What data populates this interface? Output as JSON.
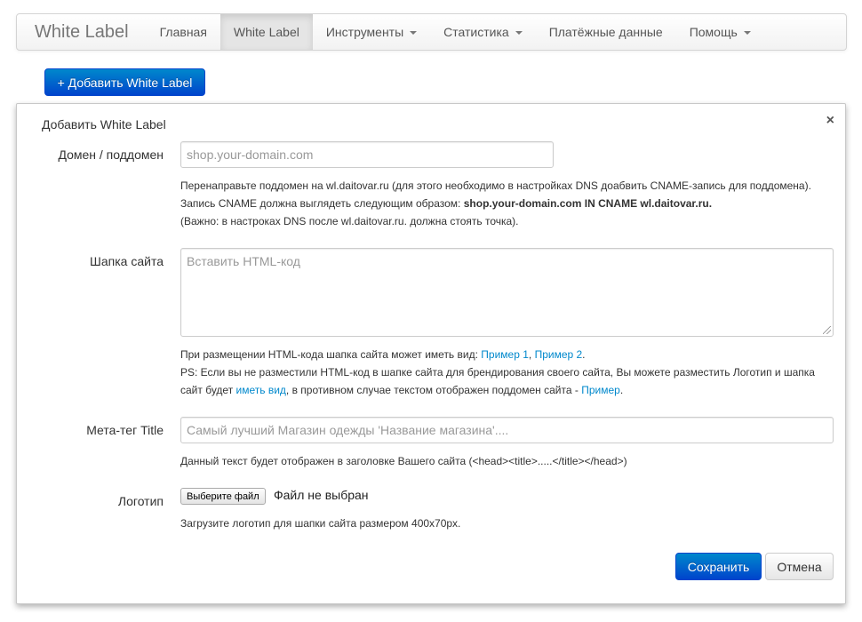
{
  "navbar": {
    "brand": "White Label",
    "items": [
      {
        "label": "Главная"
      },
      {
        "label": "White Label"
      },
      {
        "label": "Инструменты"
      },
      {
        "label": "Статистика"
      },
      {
        "label": "Платёжные данные"
      },
      {
        "label": "Помощь"
      }
    ],
    "active_item": "White Label"
  },
  "add_button": "+ Добавить White Label",
  "modal": {
    "title": "Добавить White Label",
    "close": "×",
    "domain": {
      "label": "Домен / поддомен",
      "placeholder": "shop.your-domain.com",
      "help_line1": "Перенаправьте поддомен на wl.daitovar.ru (для этого необходимо в настройках DNS доабвить CNAME-запись для поддомена).",
      "help_line2_prefix": "Запись CNAME должна выглядеть следующим образом: ",
      "help_line2_bold": "shop.your-domain.com IN CNAME wl.daitovar.ru.",
      "help_line3": "(Важно: в настроках DNS после wl.daitovar.ru. должна стоять точка)."
    },
    "header": {
      "label": "Шапка сайта",
      "placeholder": "Вставить HTML-код",
      "help_line1_prefix": "При размещении HTML-кода шапка сайта может иметь вид: ",
      "example1": "Пример 1",
      "sep": ", ",
      "example2": "Пример 2",
      "help_line1_suffix": ".",
      "help_line2": "PS: Если вы не разместили HTML-код в шапке сайта для брендирования своего сайта, Вы можете разместить Логотип и шапка",
      "help_line3_prefix": "сайт будет ",
      "view_link": "иметь вид",
      "help_line3_middle": ", в противном случае текстом отображен поддомен сайта - ",
      "example_link": "Пример",
      "help_line3_suffix": "."
    },
    "meta_title": {
      "label": "Мета-тег Title",
      "placeholder": "Самый лучший Магазин одежды 'Название магазина'....",
      "help": "Данный текст будет отображен в заголовке Вашего сайта (<head><title>.....</title></head>)"
    },
    "logo": {
      "label": "Логотип",
      "file_button": "Выберите файл",
      "file_status": "Файл не выбран",
      "help": "Загрузите логотип для шапки сайта размером 400x70px."
    },
    "save": "Сохранить",
    "cancel": "Отмена"
  },
  "colors": {
    "primary": "#0055cc",
    "link": "#0088cc"
  }
}
